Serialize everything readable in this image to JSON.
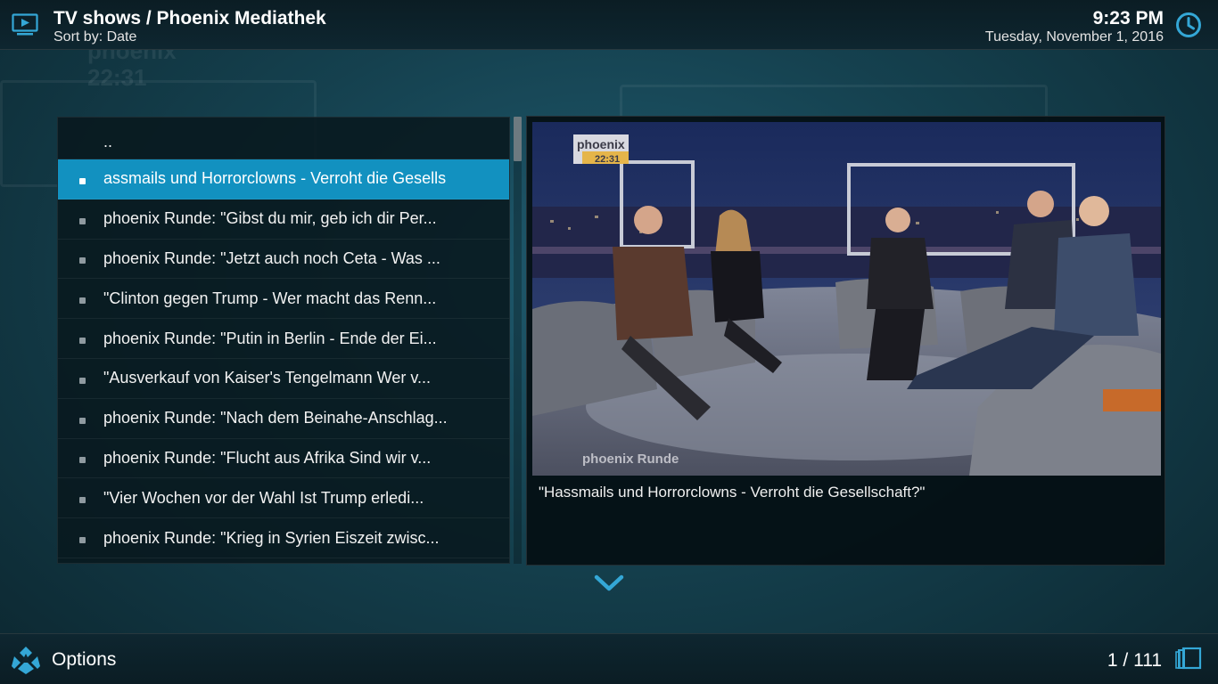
{
  "header": {
    "title": "TV shows / Phoenix Mediathek",
    "subtitle": "Sort by: Date",
    "time": "9:23 PM",
    "date": "Tuesday, November 1, 2016"
  },
  "list": {
    "items": [
      {
        "label": ".."
      },
      {
        "label": "assmails und Horrorclowns - Verroht die Gesells",
        "selected": true
      },
      {
        "label": "phoenix Runde: \"Gibst du mir, geb ich dir  Per..."
      },
      {
        "label": "phoenix Runde: \"Jetzt auch noch Ceta - Was ..."
      },
      {
        "label": "\"Clinton gegen Trump - Wer macht das Renn..."
      },
      {
        "label": "phoenix Runde: \"Putin in Berlin - Ende der Ei..."
      },
      {
        "label": "\"Ausverkauf von Kaiser's Tengelmann  Wer v..."
      },
      {
        "label": "phoenix Runde: \"Nach dem Beinahe-Anschlag..."
      },
      {
        "label": "phoenix Runde: \"Flucht aus Afrika  Sind wir v..."
      },
      {
        "label": "\"Vier Wochen vor der Wahl  Ist Trump erledi..."
      },
      {
        "label": "phoenix Runde: \"Krieg in Syrien  Eiszeit zwisc..."
      }
    ]
  },
  "info": {
    "plot": "\"Hassmails und Horrorclowns - Verroht die Gesellschaft?\"",
    "thumb_logo": "phoenix",
    "thumb_logo_time": "22:31",
    "thumb_caption": "phoenix Runde"
  },
  "footer": {
    "options_label": "Options",
    "page_count": "1 / 111"
  },
  "colors": {
    "accent": "#1291c0",
    "icon_blue": "#34a7d6"
  },
  "icons": {
    "header_left": "tv-icon",
    "header_right": "clock-icon",
    "footer_left": "options-icon",
    "footer_right": "view-mode-icon",
    "more": "chevron-down-icon"
  }
}
